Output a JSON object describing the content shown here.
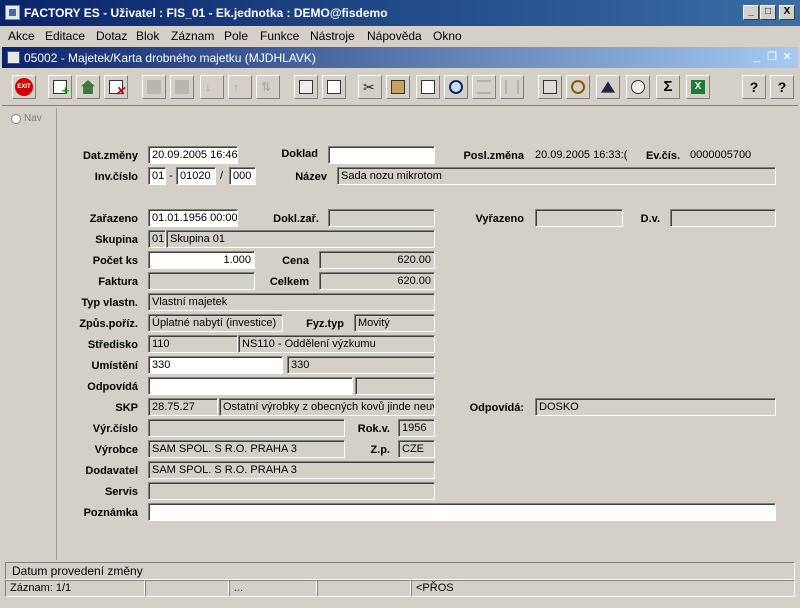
{
  "app": {
    "title": "FACTORY ES - Uživatel : FIS_01 - Ek.jednotka : DEMO@fisdemo"
  },
  "window_controls": {
    "minimize": "_",
    "maximize": "□",
    "close": "X"
  },
  "menu": [
    "Akce",
    "Editace",
    "Dotaz",
    "Blok",
    "Záznam",
    "Pole",
    "Funkce",
    "Nástroje",
    "Nápověda",
    "Okno"
  ],
  "form_window": {
    "title": "05002 - Majetek/Karta drobného majetku (MJDHLAVK)"
  },
  "toolbar": {
    "exit_label": "EXIT",
    "icons": [
      "exit-icon",
      "add-record-icon",
      "home-icon",
      "delete-record-icon",
      "disabled-save-icon",
      "disabled-copy-icon",
      "sort-asc-icon",
      "sort-desc-icon",
      "sort-multi-icon",
      "print-icon",
      "print-preview-icon",
      "cut-icon",
      "paste-icon",
      "copy-icon",
      "zoom-icon",
      "list-icon",
      "columns-icon",
      "calculator-icon",
      "wheel-icon",
      "triangle-icon",
      "money-icon",
      "sum-icon",
      "excel-icon",
      "help-question-icon",
      "help-context-icon"
    ]
  },
  "nav": {
    "label": "Nav"
  },
  "labels": {
    "dat_zmeny": "Dat.změny",
    "doklad": "Doklad",
    "posl_zmena": "Posl.změna",
    "ev_cis": "Ev.čís.",
    "inv_cislo": "Inv.číslo",
    "nazev": "Název",
    "zarazeno": "Zařazeno",
    "dokl_zar": "Dokl.zař.",
    "vyrazeno": "Vyřazeno",
    "dv": "D.v.",
    "skupina": "Skupina",
    "pocet_ks": "Počet ks",
    "cena": "Cena",
    "faktura": "Faktura",
    "celkem": "Celkem",
    "typ_vlastn": "Typ vlastn.",
    "zpus_poriz": "Způs.poříz.",
    "fyz_typ": "Fyz.typ",
    "stredisko": "Středisko",
    "umisteni": "Umístění",
    "odpovida": "Odpovídá",
    "skp": "SKP",
    "odpovida2": "Odpovídá:",
    "vyr_cislo": "Výr.číslo",
    "rok_v": "Rok.v.",
    "vyrobce": "Výrobce",
    "zp": "Z.p.",
    "dodavatel": "Dodavatel",
    "servis": "Servis",
    "poznamka": "Poznámka",
    "inv_sep": "-",
    "inv_slash": "/"
  },
  "values": {
    "dat_zmeny": "20.09.2005 16:46:",
    "doklad": "",
    "posl_zmena": "20.09.2005 16:33:(",
    "ev_cis": "0000005700",
    "inv_1": "01",
    "inv_2": "01020",
    "inv_3": "000",
    "nazev": "Sada nozu mikrotom",
    "zarazeno": "01.01.1956 00:00:",
    "dokl_zar": "",
    "vyrazeno": "",
    "dv": "",
    "skupina_kod": "01",
    "skupina_nazev": "Skupina 01",
    "pocet_ks": "1.000",
    "cena": "620.00",
    "faktura": "",
    "celkem": "620.00",
    "typ_vlastn": "Vlastní majetek",
    "zpus_poriz": "Úplatné nabytí (investice)",
    "fyz_typ": "Movitý",
    "stredisko_kod": "110",
    "stredisko_nazev": "NS110 - Oddělení výzkumu",
    "umisteni_1": "330",
    "umisteni_2": "330",
    "odpovida_1": "",
    "odpovida_2": "",
    "skp_kod": "28.75.27",
    "skp_nazev": "Ostatní výrobky z obecných kovů jinde neuv",
    "odpovida_osoba": "DOSKO",
    "vyr_cislo": "",
    "rok_v": "1956",
    "vyrobce": "SAM SPOL. S R.O.  PRAHA 3",
    "zp": "CZE",
    "dodavatel": "SAM SPOL. S R.O.  PRAHA 3",
    "servis": "",
    "poznamka": ""
  },
  "status": {
    "message": "Datum provedení změny",
    "record": "Záznam: 1/1",
    "dots": "...",
    "mode": "<PŘOS"
  }
}
